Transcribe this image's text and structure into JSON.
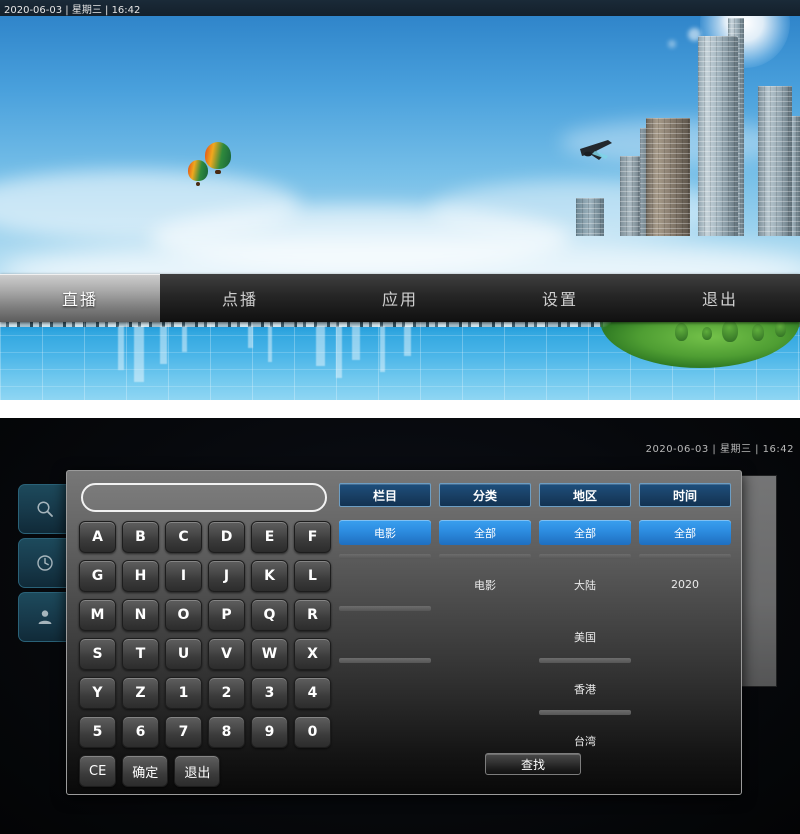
{
  "top_screen": {
    "status_bar": {
      "text": "2020-06-03 | 星期三 | 16:42"
    },
    "nav": {
      "items": [
        {
          "label": "直播",
          "selected": true
        },
        {
          "label": "点播",
          "selected": false
        },
        {
          "label": "应用",
          "selected": false
        },
        {
          "label": "设置",
          "selected": false
        },
        {
          "label": "退出",
          "selected": false
        }
      ]
    },
    "scene": {
      "description": "蓝天白云 城市天际线 湖面倒影",
      "elements": [
        "sun-flare",
        "airplane",
        "hot-air-balloons",
        "skyscrapers",
        "water-grid",
        "green-island"
      ]
    }
  },
  "bottom_screen": {
    "clock": {
      "text": "2020-06-03 | 星期三 | 16:42"
    },
    "side_tabs": [
      {
        "name": "search-icon",
        "label": "搜索"
      },
      {
        "name": "clock-icon",
        "label": "历史"
      },
      {
        "name": "user-icon",
        "label": "用户"
      }
    ],
    "search": {
      "value": "",
      "placeholder": ""
    },
    "keyboard": {
      "rows": [
        [
          "A",
          "B",
          "C",
          "D",
          "E",
          "F"
        ],
        [
          "G",
          "H",
          "I",
          "J",
          "K",
          "L"
        ],
        [
          "M",
          "N",
          "O",
          "P",
          "Q",
          "R"
        ],
        [
          "S",
          "T",
          "U",
          "V",
          "W",
          "X"
        ],
        [
          "Y",
          "Z",
          "1",
          "2",
          "3",
          "4"
        ],
        [
          "5",
          "6",
          "7",
          "8",
          "9",
          "0"
        ]
      ],
      "action_keys": [
        "CE",
        "确定",
        "退出"
      ]
    },
    "filters": [
      {
        "header": "栏目",
        "items": [
          {
            "label": "电影",
            "selected": true
          },
          {
            "label": "",
            "selected": false
          },
          {
            "label": "",
            "selected": false
          },
          {
            "label": "",
            "selected": false
          },
          {
            "label": "",
            "selected": false
          },
          {
            "label": "",
            "selected": false
          },
          {
            "label": "",
            "selected": false
          }
        ]
      },
      {
        "header": "分类",
        "items": [
          {
            "label": "全部",
            "selected": true
          },
          {
            "label": "",
            "selected": false
          },
          {
            "label": "电影",
            "selected": false
          },
          {
            "label": "",
            "selected": false
          },
          {
            "label": "",
            "selected": false
          },
          {
            "label": "",
            "selected": false
          },
          {
            "label": "",
            "selected": false
          }
        ]
      },
      {
        "header": "地区",
        "items": [
          {
            "label": "全部",
            "selected": true
          },
          {
            "label": "",
            "selected": false
          },
          {
            "label": "大陆",
            "selected": false
          },
          {
            "label": "",
            "selected": false
          },
          {
            "label": "美国",
            "selected": false
          },
          {
            "label": "",
            "selected": false
          },
          {
            "label": "香港",
            "selected": false
          },
          {
            "label": "",
            "selected": false
          },
          {
            "label": "台湾",
            "selected": false
          }
        ]
      },
      {
        "header": "时间",
        "items": [
          {
            "label": "全部",
            "selected": true
          },
          {
            "label": "",
            "selected": false
          },
          {
            "label": "2020",
            "selected": false
          },
          {
            "label": "",
            "selected": false
          },
          {
            "label": "",
            "selected": false
          },
          {
            "label": "",
            "selected": false
          },
          {
            "label": "",
            "selected": false
          }
        ]
      }
    ],
    "find_button": {
      "label": "查找"
    }
  },
  "colors": {
    "accent_blue": "#2e8ee2",
    "header_blue": "#1a4268",
    "sky_blue": "#49a0dc",
    "water_blue": "#32a7e0",
    "nav_active": "#a9a9a9"
  }
}
